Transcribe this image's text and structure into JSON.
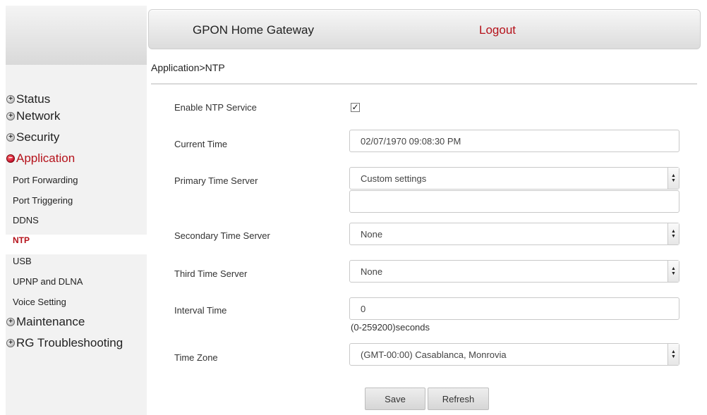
{
  "header": {
    "title": "GPON Home Gateway",
    "logout": "Logout"
  },
  "breadcrumb": "Application>NTP",
  "sidebar": {
    "sections": [
      {
        "label": "Status",
        "icon": "plus-circle-icon"
      },
      {
        "label": "Network",
        "icon": "plus-circle-icon"
      },
      {
        "label": "Security",
        "icon": "plus-circle-icon"
      },
      {
        "label": "Application",
        "icon": "minus-circle-icon",
        "active": true
      },
      {
        "label": "Maintenance",
        "icon": "plus-circle-icon"
      },
      {
        "label": "RG Troubleshooting",
        "icon": "plus-circle-icon"
      }
    ],
    "app_items": [
      {
        "label": "Port Forwarding"
      },
      {
        "label": "Port Triggering"
      },
      {
        "label": "DDNS"
      },
      {
        "label": "NTP",
        "active": true
      },
      {
        "label": "USB"
      },
      {
        "label": "UPNP and DLNA"
      },
      {
        "label": "Voice Setting"
      }
    ]
  },
  "form": {
    "enable_ntp": {
      "label": "Enable NTP Service",
      "checked": true,
      "mark": "✓"
    },
    "current_time": {
      "label": "Current Time",
      "value": "02/07/1970 09:08:30 PM"
    },
    "primary_server": {
      "label": "Primary Time Server",
      "value": "Custom settings",
      "custom_value": ""
    },
    "secondary_server": {
      "label": "Secondary Time Server",
      "value": "None"
    },
    "third_server": {
      "label": "Third Time Server",
      "value": "None"
    },
    "interval": {
      "label": "Interval Time",
      "value": "0",
      "hint": "(0-259200)seconds"
    },
    "time_zone": {
      "label": "Time Zone",
      "value": "(GMT-00:00) Casablanca, Monrovia"
    }
  },
  "buttons": {
    "save": "Save",
    "refresh": "Refresh"
  },
  "colors": {
    "accent": "#b5121b",
    "sidebar_bg": "#f2f2f2"
  }
}
